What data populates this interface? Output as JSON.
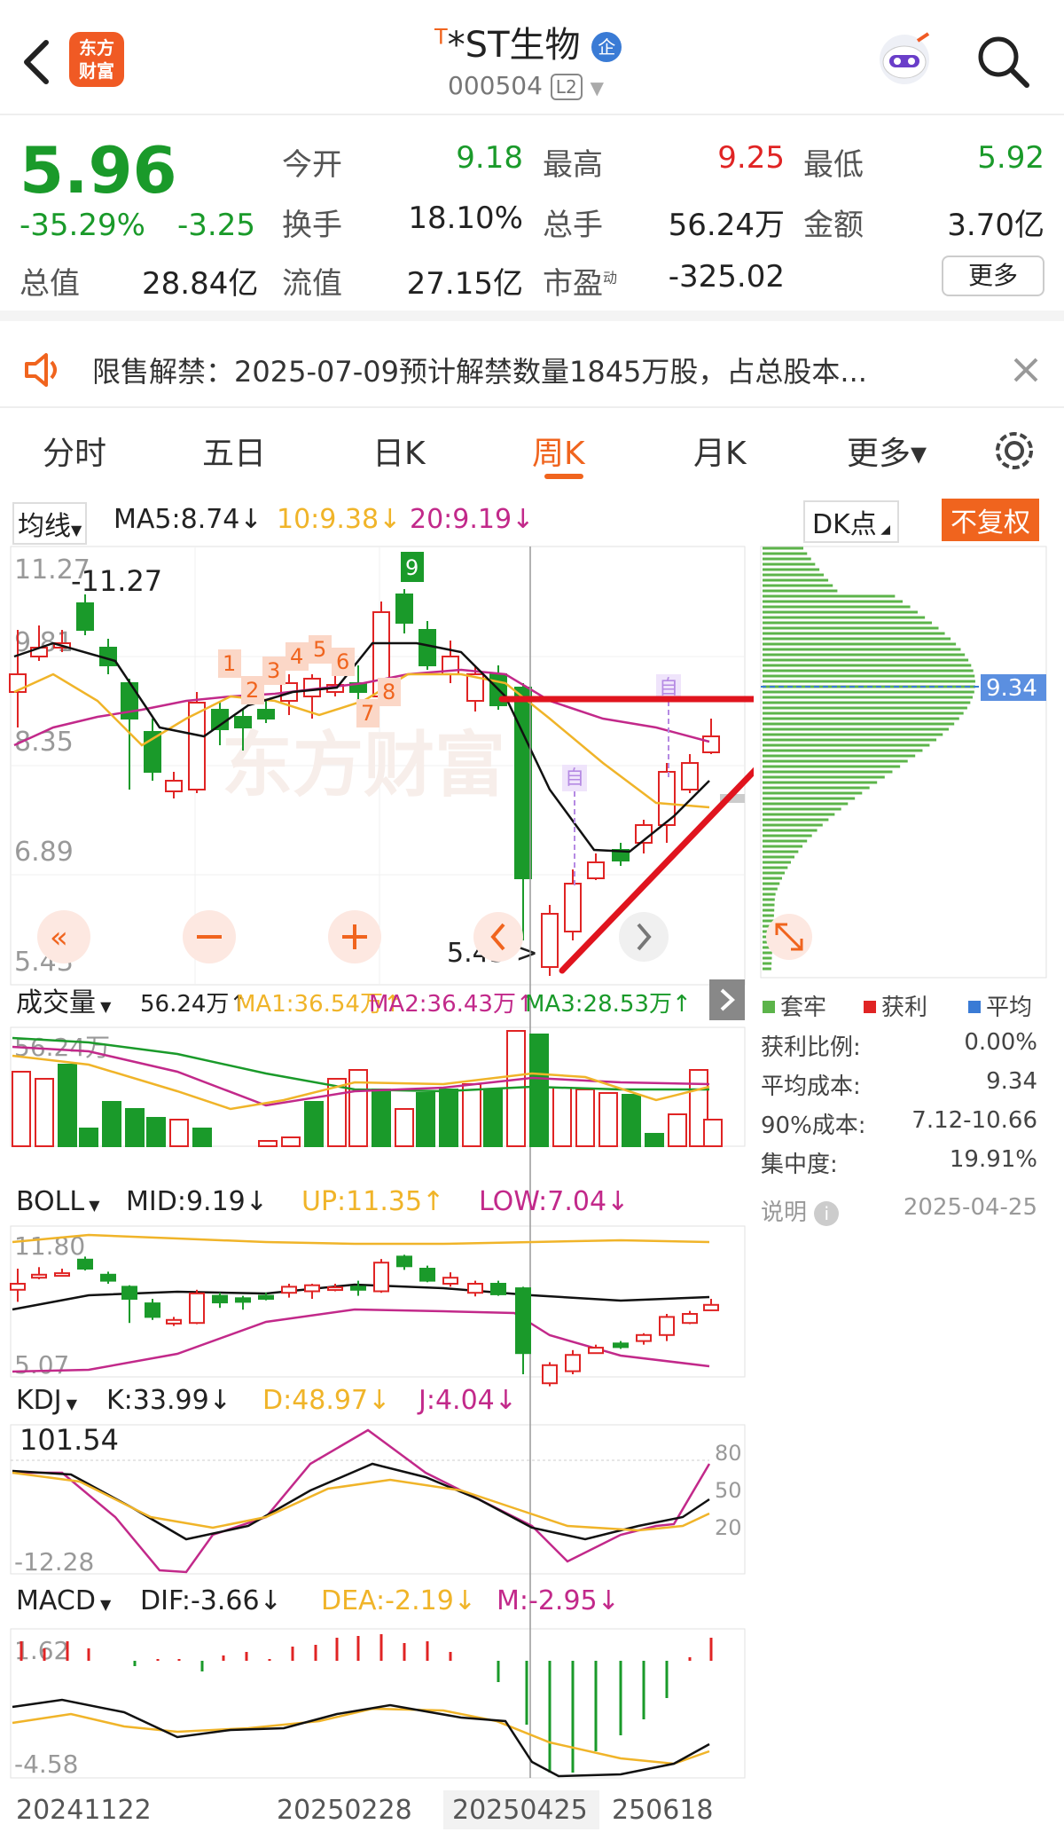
{
  "header": {
    "title_prefix": "T",
    "title": "*ST生物",
    "tag": "企",
    "code": "000504",
    "level": "L2",
    "logo_line1": "东方",
    "logo_line2": "财富"
  },
  "quote": {
    "price": "5.96",
    "change_pct": "-35.29%",
    "change_amt": "-3.25",
    "total_value_label": "总值",
    "total_value": "28.84亿",
    "open_label": "今开",
    "open": "9.18",
    "high_label": "最高",
    "high": "9.25",
    "low_label": "最低",
    "low": "5.92",
    "turnover_label": "换手",
    "turnover": "18.10%",
    "volume_label": "总手",
    "volume": "56.24万",
    "amount_label": "金额",
    "amount": "3.70亿",
    "float_label": "流值",
    "float_value": "27.15亿",
    "pe_label": "市盈",
    "pe_sup": "动",
    "pe": "-325.02",
    "more_btn": "更多"
  },
  "notice": {
    "text": "限售解禁：2025-07-09预计解禁数量1845万股，占总股本..."
  },
  "tabs": [
    {
      "label": "分时"
    },
    {
      "label": "五日"
    },
    {
      "label": "日K"
    },
    {
      "label": "周K",
      "active": true
    },
    {
      "label": "月K"
    },
    {
      "label": "更多▾"
    }
  ],
  "ma_bar": {
    "selector": "均线",
    "ma5": "MA5:8.74↓",
    "ma10": "10:9.38↓",
    "ma20": "20:9.19↓",
    "dk": "DK点",
    "fq": "不复权"
  },
  "kline": {
    "y_labels": [
      "11.27",
      "9.81",
      "8.35",
      "6.89",
      "5.43"
    ],
    "high_note": "-11.27",
    "low_note": "5.43->",
    "markers": [
      "1",
      "2",
      "3",
      "4",
      "5",
      "6",
      "7",
      "8",
      "9"
    ],
    "zi": "自",
    "watermark": "东方财富"
  },
  "chip": {
    "price_tag": "9.34",
    "legend": [
      "套牢",
      "获利",
      "平均"
    ],
    "rows": [
      {
        "label": "获利比例:",
        "value": "0.00%"
      },
      {
        "label": "平均成本:",
        "value": "9.34"
      },
      {
        "label": "90%成本:",
        "value": "7.12-10.66"
      },
      {
        "label": "集中度:",
        "value": "19.91%"
      }
    ],
    "explain": "说明",
    "date": "2025-04-25"
  },
  "volume_bar": {
    "selector": "成交量",
    "val": "56.24万↑",
    "ma1": "MA1:36.54万↑",
    "ma2": "MA2:36.43万↑",
    "ma3": "MA3:28.53万↑",
    "y_top": "56.24万"
  },
  "boll_bar": {
    "selector": "BOLL",
    "mid": "MID:9.19↓",
    "up": "UP:11.35↑",
    "low": "LOW:7.04↓",
    "y_top": "11.80",
    "y_bottom": "5.07"
  },
  "kdj_bar": {
    "selector": "KDJ",
    "k": "K:33.99↓",
    "d": "D:48.97↓",
    "j": "J:4.04↓",
    "y_top": "101.54",
    "y_bottom": "-12.28",
    "levels": [
      "80",
      "50",
      "20"
    ]
  },
  "macd_bar": {
    "selector": "MACD",
    "dif": "DIF:-3.66↓",
    "dea": "DEA:-2.19↓",
    "m": "M:-2.95↓",
    "y_top": "1.62",
    "y_bottom": "-4.58"
  },
  "x_dates": [
    "20241122",
    "20250228",
    "20250425",
    "250618"
  ],
  "colors": {
    "up": "#e02424",
    "down": "#1a9a2a",
    "accent": "#f0641e",
    "ma10": "#f0b429",
    "ma20": "#c2298a"
  }
}
